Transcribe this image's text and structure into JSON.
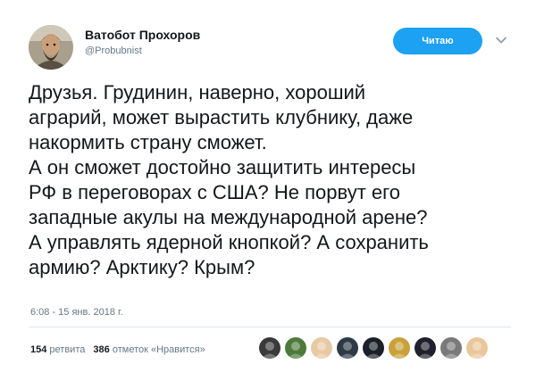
{
  "author": {
    "display_name": "Ватобот Прохоров",
    "username": "@Probubnist",
    "avatar_icon": "avatar-icon"
  },
  "follow_button": {
    "label": "Читаю"
  },
  "tweet": {
    "lines": [
      "Друзья. Грудинин, наверно, хороший",
      "аграрий, может вырастить клубнику, даже",
      "накормить страну сможет.",
      "А он сможет достойно защитить интересы",
      "РФ в переговорах с США? Не порвут его",
      "западные акулы на международной арене?",
      "А управлять ядерной кнопкой? А сохранить",
      "армию? Арктику? Крым?"
    ],
    "timestamp": "6:08 - 15 янв. 2018 г."
  },
  "stats": {
    "retweets_count": "154",
    "retweets_label": "ретвита",
    "likes_count": "386",
    "likes_label": "отметок «Нравится»"
  },
  "likers": [
    {
      "icon": "liker-avatar-icon",
      "color": "#3a3a3a"
    },
    {
      "icon": "liker-avatar-icon",
      "color": "#4d7a3a"
    },
    {
      "icon": "liker-avatar-icon",
      "color": "#e7c9a3"
    },
    {
      "icon": "liker-avatar-icon",
      "color": "#2d3a46"
    },
    {
      "icon": "liker-avatar-icon",
      "color": "#1c2129"
    },
    {
      "icon": "liker-avatar-icon",
      "color": "#c9a13a"
    },
    {
      "icon": "liker-avatar-icon",
      "color": "#1f1f2e"
    },
    {
      "icon": "liker-avatar-icon",
      "color": "#7a7a7a"
    },
    {
      "icon": "liker-avatar-icon",
      "color": "#e9c79a"
    }
  ],
  "colors": {
    "accent": "#1da1f2",
    "text": "#14171a",
    "muted": "#657786"
  }
}
